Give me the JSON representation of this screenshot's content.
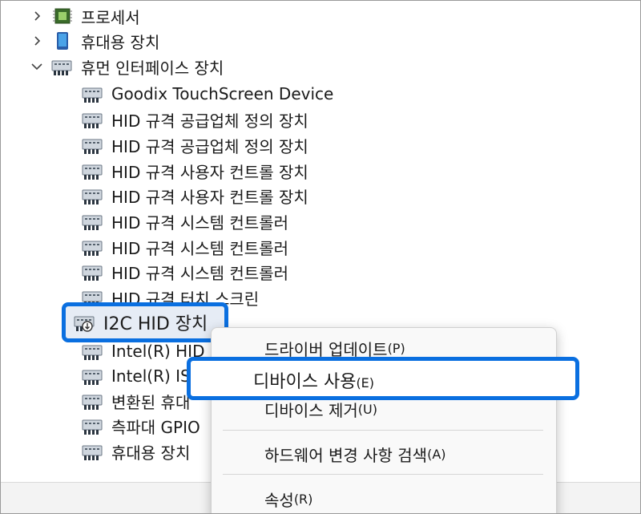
{
  "tree": {
    "categories": [
      {
        "label": "프로세서",
        "expanded": false,
        "icon": "processor-icon"
      },
      {
        "label": "휴대용 장치",
        "expanded": false,
        "icon": "portable-device-icon"
      },
      {
        "label": "휴먼 인터페이스 장치",
        "expanded": true,
        "icon": "hid-icon"
      }
    ],
    "children": [
      "Goodix TouchScreen Device",
      "HID 규격 공급업체 정의 장치",
      "HID 규격 공급업체 정의 장치",
      "HID 규격 사용자 컨트롤 장치",
      "HID 규격 사용자 컨트롤 장치",
      "HID 규격 시스템 컨트롤러",
      "HID 규격 시스템 컨트롤러",
      "HID 규격 시스템 컨트롤러",
      "HID 규격 터치 스크린",
      "I2C HID 장치",
      "Intel(R) HID E",
      "Intel(R) ISS",
      "변환된 휴대",
      "측파대 GPIO",
      "휴대용 장치 "
    ],
    "selected_index": 9
  },
  "context_menu": {
    "items": [
      {
        "label": "드라이버 업데이트",
        "shortcut": "(P)"
      },
      {
        "label": "디바이스 사용",
        "shortcut": "(E)"
      },
      {
        "label": "디바이스 제거",
        "shortcut": "(U)"
      },
      {
        "label": "하드웨어 변경 사항 검색",
        "shortcut": "(A)"
      },
      {
        "label": "속성",
        "shortcut": "(R)"
      }
    ],
    "highlighted_index": 1
  },
  "colors": {
    "highlight_border": "#0a6fe0",
    "selection_bg": "#e6ecf5",
    "menu_bg": "#f9f9f9"
  }
}
